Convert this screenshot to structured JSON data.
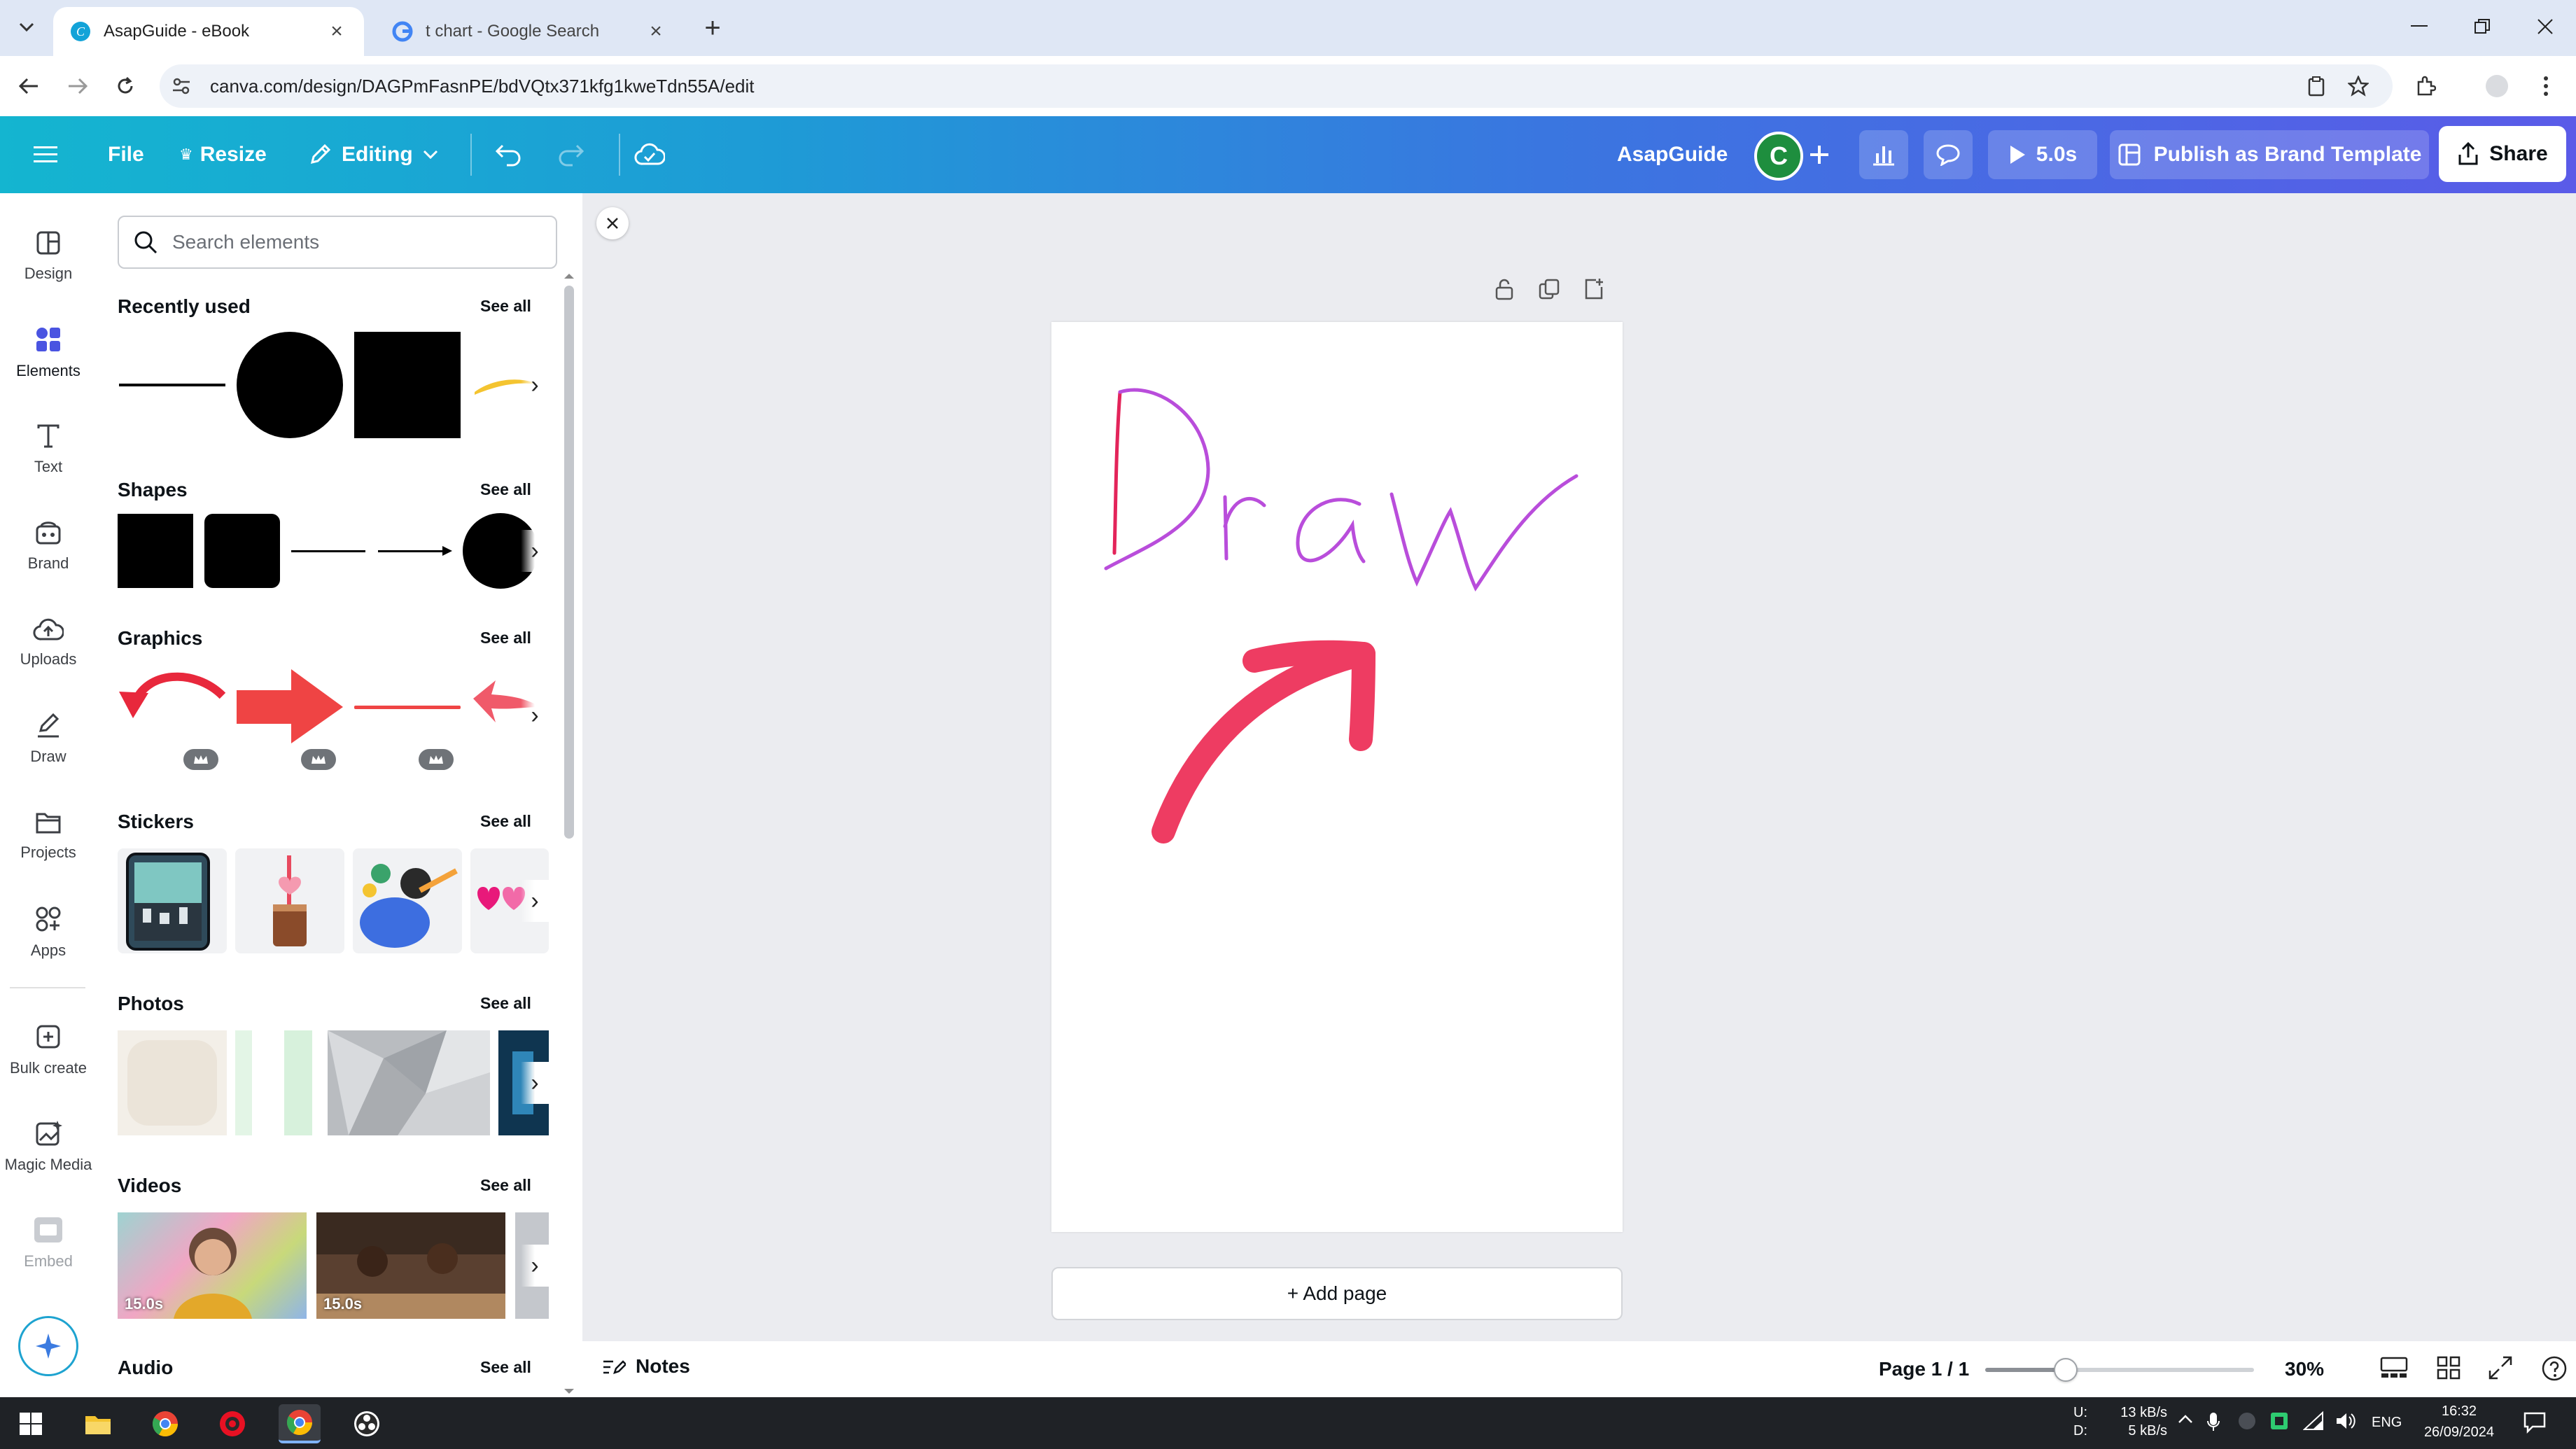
{
  "browser": {
    "tabs": [
      {
        "title": "AsapGuide - eBook",
        "active": true
      },
      {
        "title": "t chart - Google Search",
        "active": false
      }
    ],
    "url": "canva.com/design/DAGPmFasnPE/bdVQtx371kfg1kweTdn55A/edit"
  },
  "toolbar": {
    "file": "File",
    "resize": "Resize",
    "editing": "Editing",
    "brand_name": "AsapGuide",
    "avatar_initial": "C",
    "play_duration": "5.0s",
    "publish": "Publish as Brand Template",
    "share": "Share",
    "accent": "#1e9bd6"
  },
  "rail": {
    "items": [
      {
        "label": "Design",
        "icon": "design-icon"
      },
      {
        "label": "Elements",
        "icon": "elements-icon",
        "active": true
      },
      {
        "label": "Text",
        "icon": "text-icon"
      },
      {
        "label": "Brand",
        "icon": "brand-icon"
      },
      {
        "label": "Uploads",
        "icon": "uploads-icon"
      },
      {
        "label": "Draw",
        "icon": "draw-icon"
      },
      {
        "label": "Projects",
        "icon": "projects-icon"
      },
      {
        "label": "Apps",
        "icon": "apps-icon"
      },
      {
        "label": "Bulk create",
        "icon": "bulk-create-icon"
      },
      {
        "label": "Magic Media",
        "icon": "magic-media-icon"
      },
      {
        "label": "Embed",
        "icon": "embed-icon"
      }
    ]
  },
  "panel": {
    "search_placeholder": "Search elements",
    "see_all": "See all",
    "sections": {
      "recently_used": "Recently used",
      "shapes": "Shapes",
      "graphics": "Graphics",
      "stickers": "Stickers",
      "photos": "Photos",
      "videos": "Videos",
      "audio": "Audio"
    },
    "videos": [
      {
        "duration": "15.0s"
      },
      {
        "duration": "15.0s"
      }
    ]
  },
  "canvas": {
    "drawn_text": "Draw",
    "add_page": "+ Add page"
  },
  "status": {
    "notes": "Notes",
    "page": "Page 1 / 1",
    "zoom_pct": "30%",
    "zoom_fraction": 0.3
  },
  "taskbar": {
    "net_up_label": "U:",
    "net_down_label": "D:",
    "net_up": "13 kB/s",
    "net_down": "5 kB/s",
    "lang": "ENG",
    "time": "16:32",
    "date": "26/09/2024"
  }
}
